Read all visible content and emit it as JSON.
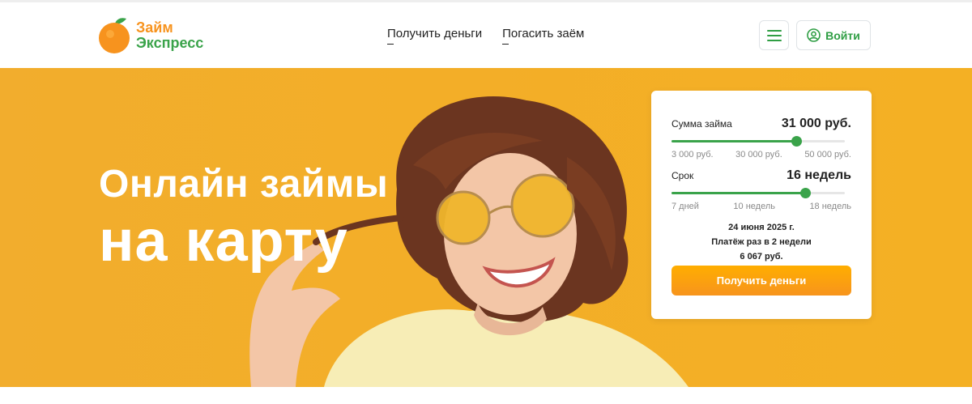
{
  "brand": {
    "line1": "Займ",
    "line2": "Экспресс",
    "orange": "#f7931e",
    "green": "#3aa34a"
  },
  "nav": {
    "items": [
      {
        "label": "Получить деньги"
      },
      {
        "label": "Погасить заём"
      }
    ]
  },
  "header": {
    "menu_icon": "hamburger-icon",
    "login_label": "Войти",
    "login_icon": "user-circle-icon"
  },
  "hero": {
    "title_line1": "Онлайн займы",
    "title_line2": "на карту",
    "background": "#f3ae28"
  },
  "calculator": {
    "amount": {
      "label": "Сумма займа",
      "value": "31 000 руб.",
      "fraction": 0.72,
      "ticks": [
        "3 000 руб.",
        "30 000 руб.",
        "50 000 руб."
      ]
    },
    "term": {
      "label": "Срок",
      "value": "16 недель",
      "fraction": 0.77,
      "ticks": [
        "7 дней",
        "10 недель",
        "18 недель"
      ]
    },
    "summary": {
      "date": "24 июня 2025 г.",
      "schedule": "Платёж раз в 2 недели",
      "payment": "6 067 руб."
    },
    "submit_label": "Получить деньги"
  }
}
